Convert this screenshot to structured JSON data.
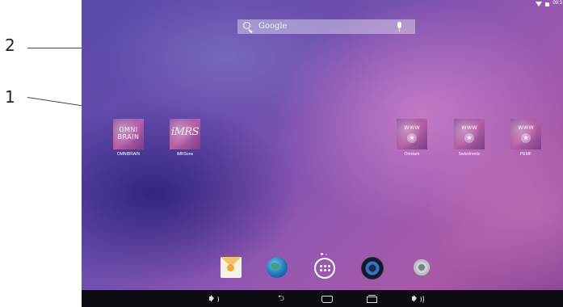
{
  "callouts": {
    "label_2": "2",
    "label_1": "1"
  },
  "status_bar": {
    "time": "09:3"
  },
  "search": {
    "placeholder": "Google"
  },
  "apps": [
    {
      "label": "OMNIBRAIN",
      "tile_text": "OMNI BRAIN"
    },
    {
      "label": "iMRSone",
      "tile_text": "iMRS"
    },
    {
      "label": "Omnium",
      "tile_text": "www"
    },
    {
      "label": "Swissfrontic",
      "tile_text": "www"
    },
    {
      "label": "PEMF",
      "tile_text": "www"
    }
  ],
  "page_indicator": {
    "current": 1,
    "total": 2
  },
  "dock": [
    "email-icon",
    "browser-icon",
    "all-apps-icon",
    "music-icon",
    "settings-icon"
  ],
  "nav_bar": [
    "volume-down-icon",
    "back-icon",
    "home-icon",
    "recents-icon",
    "volume-up-icon"
  ],
  "colors": {
    "wallpaper_primary": "#6d4eae",
    "wallpaper_secondary": "#a85aa8",
    "nav_bar": "#0c0c12"
  }
}
